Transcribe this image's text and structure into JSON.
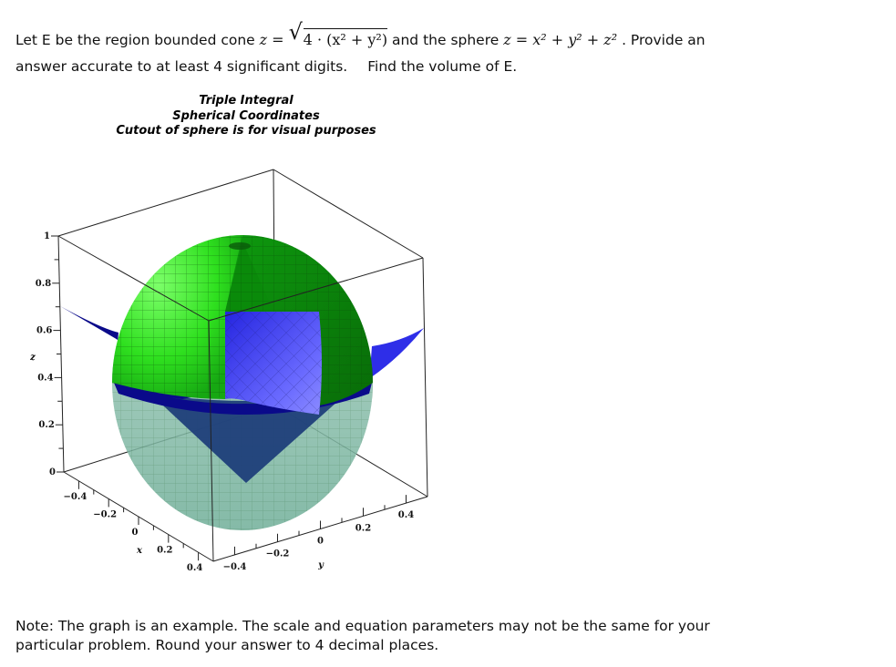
{
  "question": {
    "line1_prefix": "Let E be the region bounded cone ",
    "cone_equation": {
      "lhs": "z",
      "eq": "=",
      "radicand": "4 · (x² + y²)"
    },
    "line1_middle": " and the sphere ",
    "sphere_equation": {
      "lhs": "z",
      "eq": "=",
      "rhs": "x² + y² + z²"
    },
    "line1_suffix": " . Provide an",
    "line2_part1": "answer accurate to at least 4 significant digits.",
    "line2_part2": "Find the volume of E."
  },
  "figure": {
    "title_lines": [
      "Triple Integral",
      "Spherical Coordinates",
      "Cutout of sphere is for visual purposes"
    ],
    "z_axis": {
      "label": "z",
      "ticks": [
        "0",
        "0.2",
        "0.4",
        "0.6",
        "0.8",
        "1"
      ],
      "range": [
        0,
        1
      ]
    },
    "x_axis": {
      "label": "x",
      "ticks": [
        "-0.4",
        "-0.2",
        "0",
        "0.2",
        "0.4"
      ],
      "range": [
        -0.5,
        0.5
      ]
    },
    "y_axis": {
      "label": "y",
      "ticks": [
        "-0.4",
        "-0.2",
        "0",
        "0.2",
        "0.4"
      ],
      "range": [
        -0.5,
        0.5
      ]
    },
    "colors": {
      "sphere_light": "#33dd22",
      "sphere_dark": "#0b8a0b",
      "sphere_transparent": "#7fb8a0",
      "cone_dark": "#0a0a8a",
      "cone_bright": "#3a3af0",
      "cone_lower": "#1f3f7a"
    }
  },
  "note": {
    "line1": "Note:  The graph is an example.  The scale and equation parameters may not be the same for your",
    "line2": "particular problem.  Round your answer to 4 decimal places."
  }
}
